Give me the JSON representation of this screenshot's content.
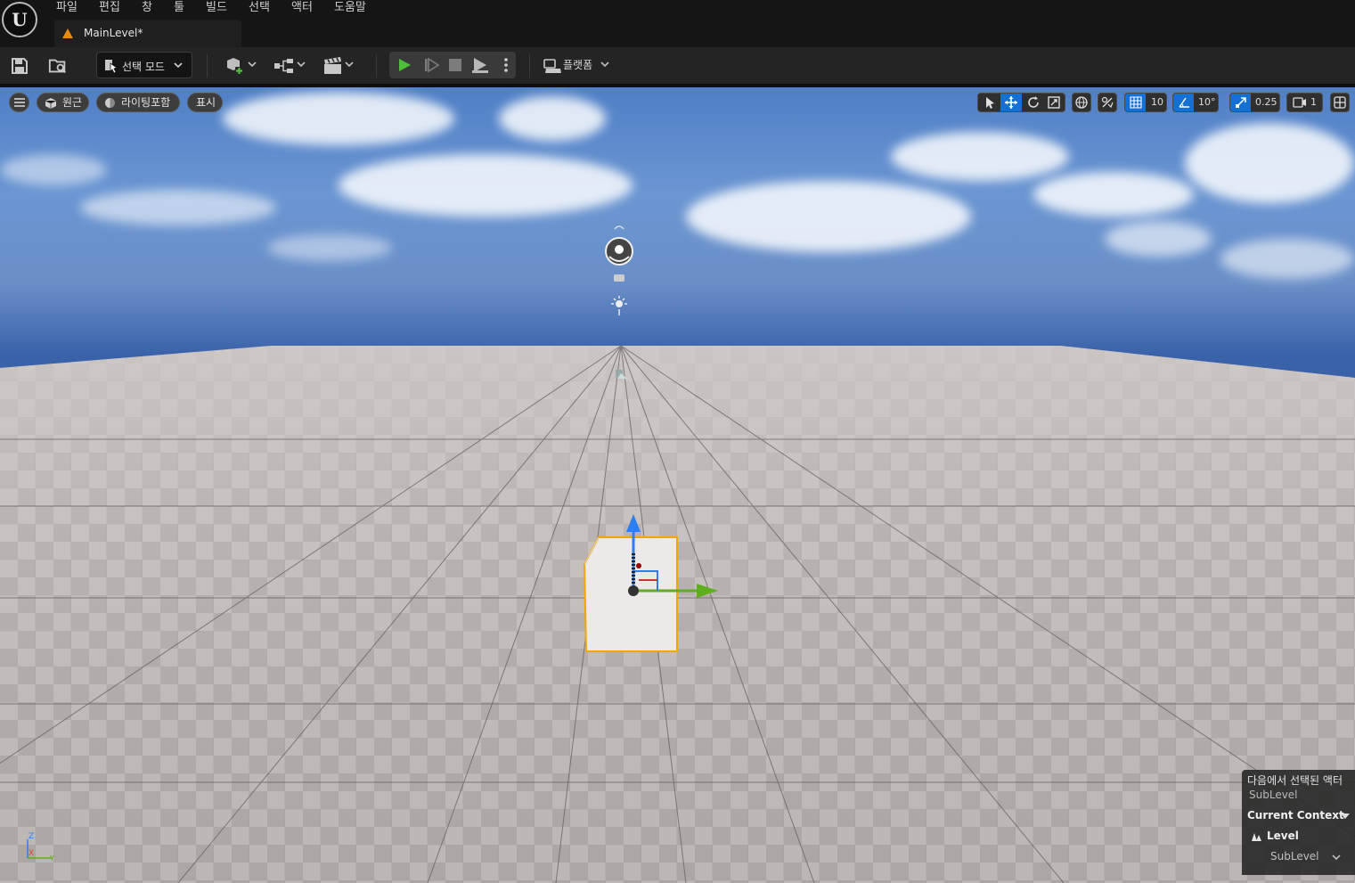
{
  "menu": {
    "file": "파일",
    "edit": "편집",
    "window": "창",
    "tools": "툴",
    "build": "빌드",
    "select": "선택",
    "actor": "액터",
    "help": "도움말"
  },
  "tab": {
    "label": "MainLevel*"
  },
  "toolbar": {
    "mode_label": "선택 모드",
    "platform_label": "플랫폼"
  },
  "viewport": {
    "perspective_label": "원근",
    "lighting_label": "라이팅포함",
    "show_label": "표시",
    "grid_snap_value": "10",
    "rotation_snap_value": "10°",
    "scale_snap_value": "0.25",
    "camera_speed_value": "1",
    "axis": {
      "z": "Z",
      "x": "X",
      "y": "Y"
    }
  },
  "context_panel": {
    "selected_from_label": "다음에서 선택된 액터",
    "selected_from_value": "SubLevel",
    "current_context_label": "Current Context",
    "level_label": "Level",
    "sublevel_value": "SubLevel"
  },
  "colors": {
    "accent_blue": "#1570d4",
    "play_green": "#4fbe3a",
    "selection_orange": "#f0a800",
    "gizmo_z": "#2b7ff0",
    "gizmo_y": "#5fae1d"
  }
}
